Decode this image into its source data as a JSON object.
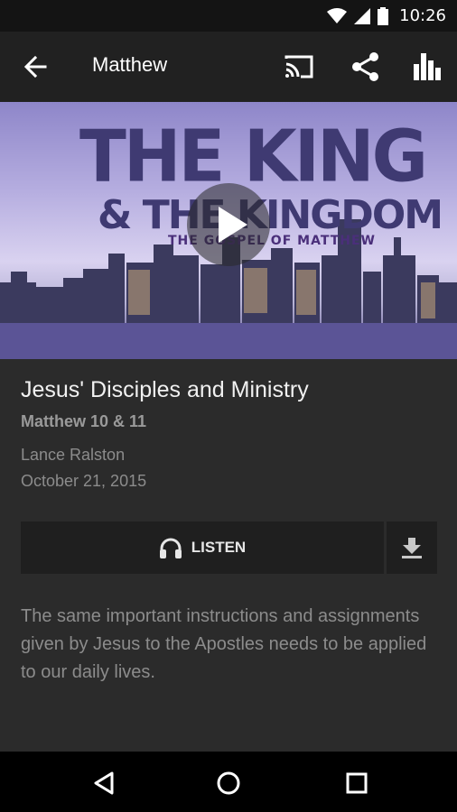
{
  "status_bar": {
    "time": "10:26",
    "icons": [
      "wifi-icon",
      "signal-icon",
      "battery-icon"
    ]
  },
  "toolbar": {
    "title": "Matthew",
    "icons": [
      "back-arrow-icon",
      "cast-icon",
      "share-icon",
      "bar-chart-icon"
    ]
  },
  "hero": {
    "line1": "THE KING",
    "line2": "& THE KINGDOM",
    "line3": "THE GOSPEL OF MATTHEW",
    "accent": "#3f3a72"
  },
  "episode": {
    "title": "Jesus' Disciples and Ministry",
    "reference": "Matthew 10 & 11",
    "author": "Lance Ralston",
    "date": "October 21, 2015",
    "listen_label": "LISTEN",
    "description": "The same important instructions and assignments given by Jesus to the Apostles needs to be applied to our daily lives."
  },
  "nav_bar": {
    "icons": [
      "back-triangle-icon",
      "home-circle-icon",
      "recents-square-icon"
    ]
  }
}
